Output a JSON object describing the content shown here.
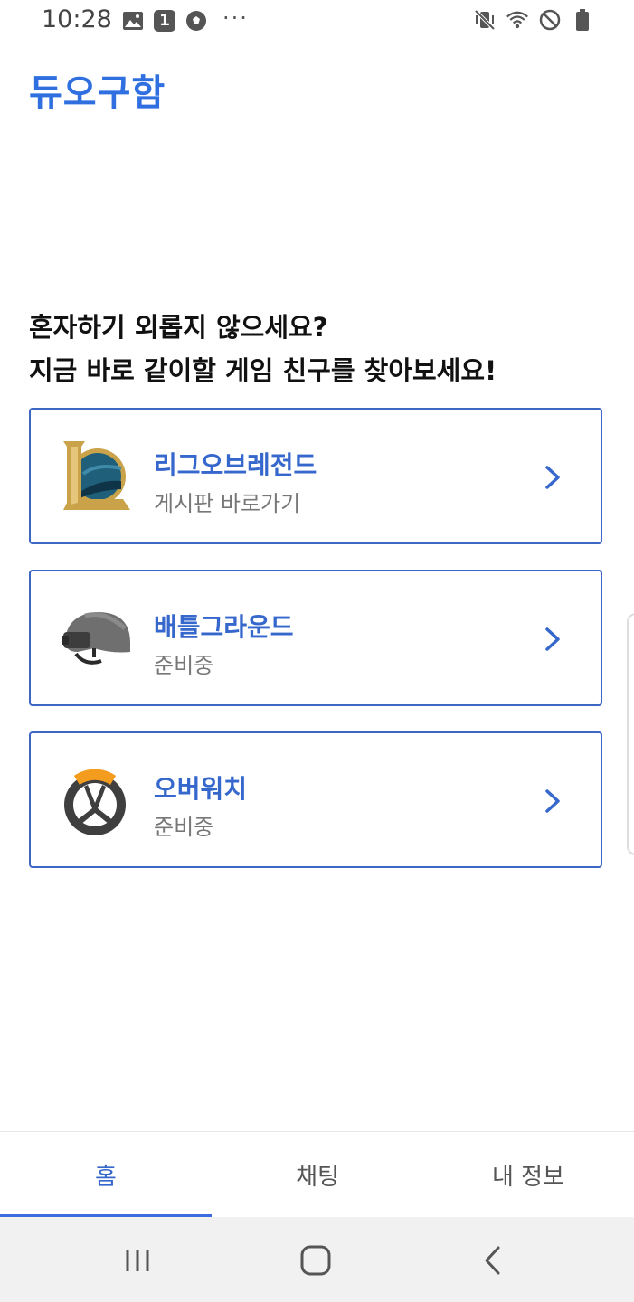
{
  "status_bar": {
    "time": "10:28",
    "left_icons": [
      "gallery-icon",
      "notification-1-icon",
      "soccer-ball-icon",
      "more-dots-icon"
    ],
    "badge_text": "1",
    "dots": "···",
    "right_icons": [
      "mute-vibrate-icon",
      "wifi-icon",
      "do-not-disturb-icon",
      "battery-icon"
    ]
  },
  "app": {
    "title": "듀오구함"
  },
  "headline": {
    "line1": "혼자하기 외롭지 않으세요?",
    "line2": "지금 바로 같이할 게임 친구를 찾아보세요!"
  },
  "games": [
    {
      "title": "리그오브레전드",
      "subtitle": "게시판 바로가기",
      "icon": "league-of-legends-icon"
    },
    {
      "title": "배틀그라운드",
      "subtitle": "준비중",
      "icon": "pubg-helmet-icon"
    },
    {
      "title": "오버워치",
      "subtitle": "준비중",
      "icon": "overwatch-icon"
    }
  ],
  "bottom_nav": {
    "tabs": [
      {
        "label": "홈",
        "active": true
      },
      {
        "label": "채팅",
        "active": false
      },
      {
        "label": "내 정보",
        "active": false
      }
    ]
  },
  "system_nav": [
    "recent-apps-icon",
    "home-icon",
    "back-icon"
  ],
  "colors": {
    "accent": "#2f6fe0",
    "card_border": "#3c67c4",
    "card_title": "#3567cc",
    "subtitle": "#777777",
    "overwatch_orange": "#f39c1e"
  }
}
